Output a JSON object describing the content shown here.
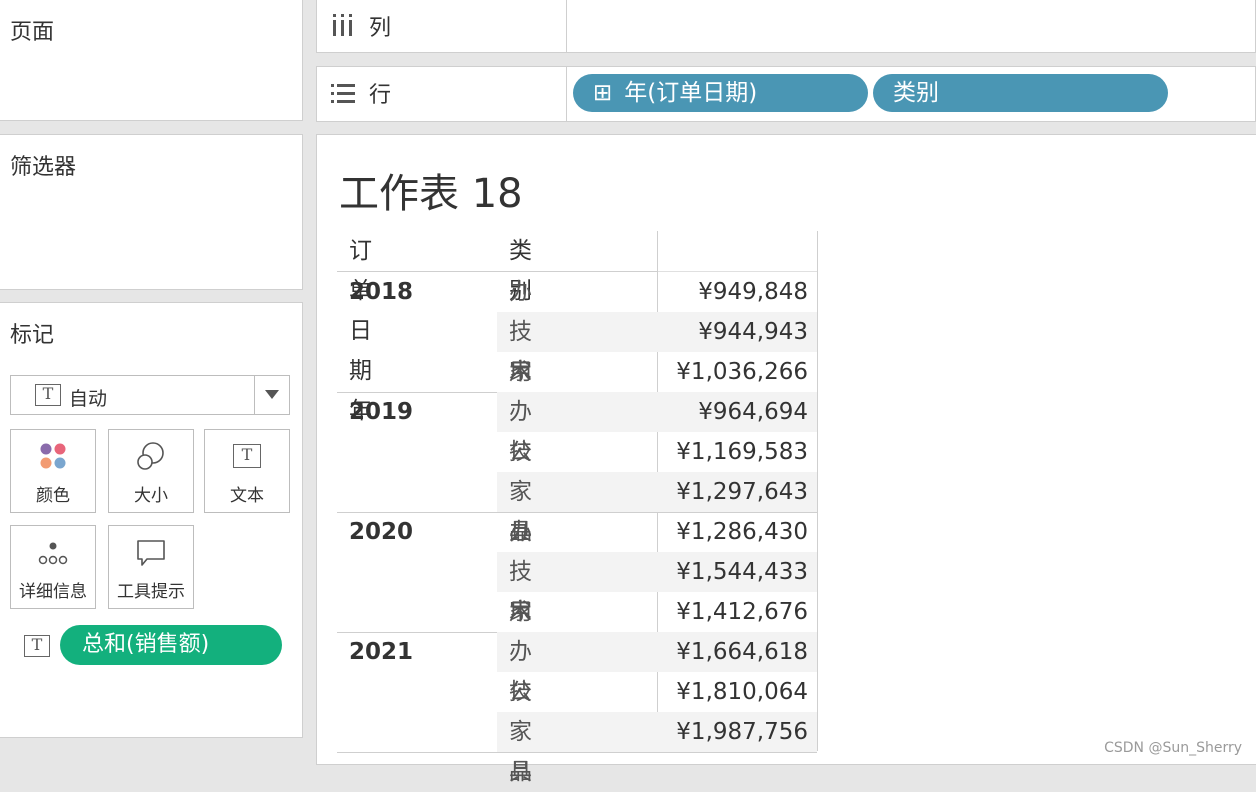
{
  "pages": {
    "title": "页面"
  },
  "filters": {
    "title": "筛选器"
  },
  "marks": {
    "title": "标记",
    "mark_type": "自动",
    "buttons": [
      {
        "label": "颜色",
        "icon": "color-icon"
      },
      {
        "label": "大小",
        "icon": "size-icon"
      },
      {
        "label": "文本",
        "icon": "text-icon"
      },
      {
        "label": "详细信息",
        "icon": "detail-icon"
      },
      {
        "label": "工具提示",
        "icon": "tooltip-icon"
      }
    ],
    "field": "总和(销售额)"
  },
  "columns_shelf": {
    "label": "列",
    "icon": "columns-icon"
  },
  "rows_shelf": {
    "label": "行",
    "icon": "rows-icon",
    "pills": [
      {
        "label": "年(订单日期)",
        "expand": "⊞"
      },
      {
        "label": "类别"
      }
    ]
  },
  "sheet": {
    "title": "工作表 18",
    "headers": [
      "订单日期 年",
      "类别",
      ""
    ],
    "rows": [
      {
        "year": "2018",
        "cats": [
          [
            "办公用品",
            "¥949,848"
          ],
          [
            "技术",
            "¥944,943"
          ],
          [
            "家具",
            "¥1,036,266"
          ]
        ]
      },
      {
        "year": "2019",
        "cats": [
          [
            "办公用品",
            "¥964,694"
          ],
          [
            "技术",
            "¥1,169,583"
          ],
          [
            "家具",
            "¥1,297,643"
          ]
        ]
      },
      {
        "year": "2020",
        "cats": [
          [
            "办公用品",
            "¥1,286,430"
          ],
          [
            "技术",
            "¥1,544,433"
          ],
          [
            "家具",
            "¥1,412,676"
          ]
        ]
      },
      {
        "year": "2021",
        "cats": [
          [
            "办公用品",
            "¥1,664,618"
          ],
          [
            "技术",
            "¥1,810,064"
          ],
          [
            "家具",
            "¥1,987,756"
          ]
        ]
      }
    ]
  },
  "watermark": "CSDN @Sun_Sherry",
  "colors": {
    "pill_blue": "#4a96b4",
    "pill_green": "#13b07d"
  }
}
